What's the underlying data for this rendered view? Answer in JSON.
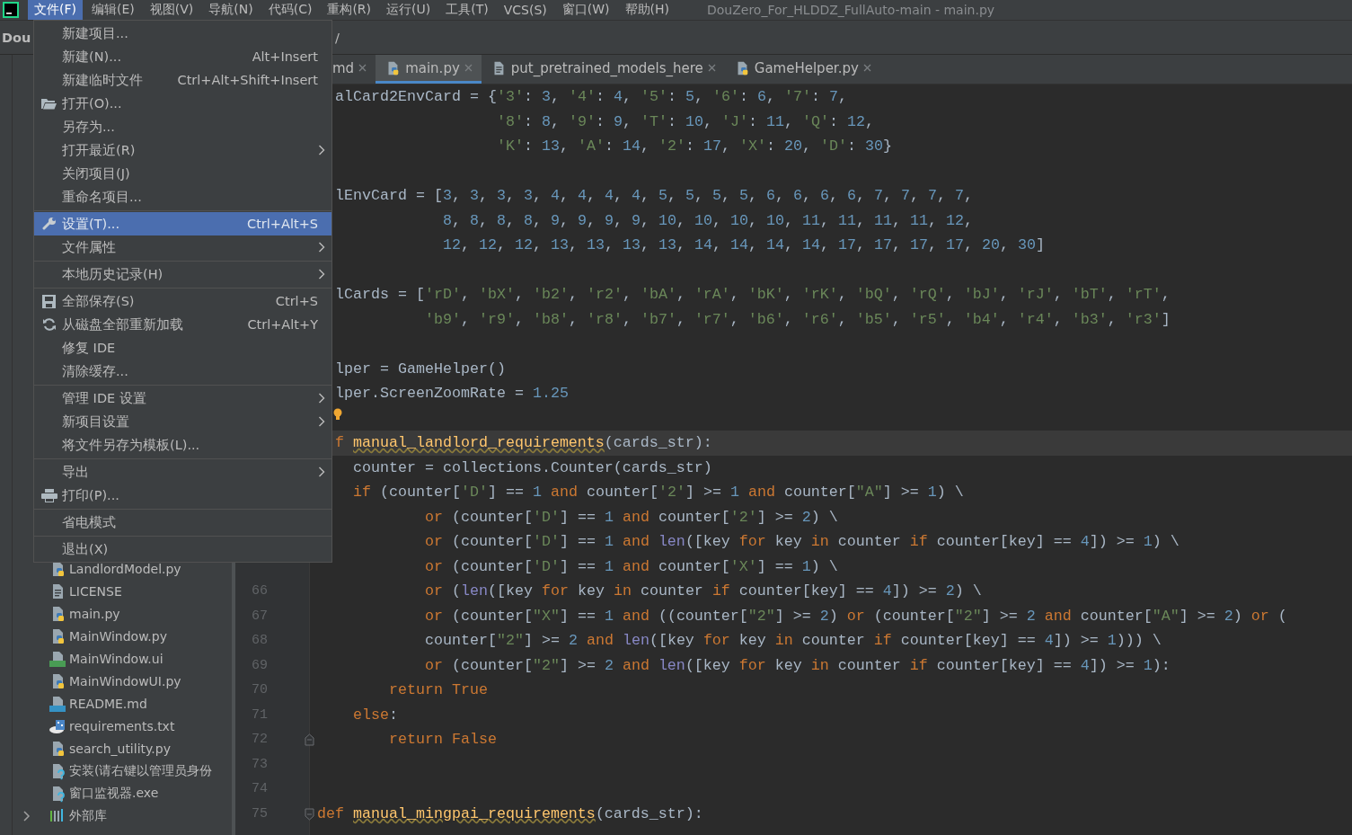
{
  "menu_bar": {
    "items": [
      {
        "label": "文件(F)",
        "selected": true
      },
      {
        "label": "编辑(E)",
        "selected": false
      },
      {
        "label": "视图(V)",
        "selected": false
      },
      {
        "label": "导航(N)",
        "selected": false
      },
      {
        "label": "代码(C)",
        "selected": false
      },
      {
        "label": "重构(R)",
        "selected": false
      },
      {
        "label": "运行(U)",
        "selected": false
      },
      {
        "label": "工具(T)",
        "selected": false
      },
      {
        "label": "VCS(S)",
        "selected": false
      },
      {
        "label": "窗口(W)",
        "selected": false
      },
      {
        "label": "帮助(H)",
        "selected": false
      }
    ],
    "title": "DouZero_For_HLDDZ_FullAuto-main - main.py"
  },
  "navigation_bar": {
    "crumbs": [
      "Dou",
      "/"
    ]
  },
  "file_menu": {
    "groups": [
      {
        "items": [
          {
            "label": "新建项目...",
            "submenu": false,
            "selected": false
          },
          {
            "label": "新建(N)...",
            "shortcut": "Alt+Insert",
            "submenu": false,
            "selected": false
          },
          {
            "label": "新建临时文件",
            "shortcut": "Ctrl+Alt+Shift+Insert",
            "submenu": false,
            "selected": false
          },
          {
            "label": "打开(O)...",
            "kind": "folder",
            "submenu": false,
            "selected": false
          },
          {
            "label": "另存为...",
            "submenu": false,
            "selected": false
          },
          {
            "label": "打开最近(R)",
            "submenu": true,
            "selected": false
          },
          {
            "label": "关闭项目(J)",
            "submenu": false,
            "selected": false
          },
          {
            "label": "重命名项目...",
            "submenu": false,
            "selected": false
          }
        ]
      },
      {
        "items": [
          {
            "label": "设置(T)...",
            "shortcut": "Ctrl+Alt+S",
            "kind": "wrench",
            "submenu": false,
            "selected": true
          },
          {
            "label": "文件属性",
            "submenu": true,
            "selected": false
          }
        ]
      },
      {
        "items": [
          {
            "label": "本地历史记录(H)",
            "submenu": true,
            "selected": false
          }
        ]
      },
      {
        "items": [
          {
            "label": "全部保存(S)",
            "shortcut": "Ctrl+S",
            "kind": "save",
            "submenu": false,
            "selected": false
          },
          {
            "label": "从磁盘全部重新加载",
            "shortcut": "Ctrl+Alt+Y",
            "kind": "reload",
            "submenu": false,
            "selected": false
          },
          {
            "label": "修复 IDE",
            "submenu": false,
            "selected": false
          },
          {
            "label": "清除缓存...",
            "submenu": false,
            "selected": false
          }
        ]
      },
      {
        "items": [
          {
            "label": "管理 IDE 设置",
            "submenu": true,
            "selected": false
          },
          {
            "label": "新项目设置",
            "submenu": true,
            "selected": false
          },
          {
            "label": "将文件另存为模板(L)...",
            "submenu": false,
            "selected": false
          }
        ]
      },
      {
        "items": [
          {
            "label": "导出",
            "submenu": true,
            "selected": false
          },
          {
            "label": "打印(P)...",
            "kind": "printer",
            "submenu": false,
            "selected": false
          }
        ]
      },
      {
        "items": [
          {
            "label": "省电模式",
            "submenu": false,
            "selected": false
          }
        ]
      },
      {
        "items": [
          {
            "label": "退出(X)",
            "submenu": false,
            "selected": false
          }
        ]
      }
    ]
  },
  "project_tree": {
    "items": [
      {
        "kind": "python",
        "label": "LandlordModel.py"
      },
      {
        "kind": "text",
        "label": "LICENSE"
      },
      {
        "kind": "python",
        "label": "main.py"
      },
      {
        "kind": "python",
        "label": "MainWindow.py"
      },
      {
        "kind": "qt",
        "label": "MainWindow.ui"
      },
      {
        "kind": "python",
        "label": "MainWindowUI.py"
      },
      {
        "kind": "markdown",
        "label": "README.md"
      },
      {
        "kind": "requirements",
        "label": "requirements.txt"
      },
      {
        "kind": "python",
        "label": "search_utility.py"
      },
      {
        "kind": "unknown",
        "label": "安装(请右键以管理员身份"
      },
      {
        "kind": "unknown",
        "label": "窗口监视器.exe"
      },
      {
        "kind": "library",
        "label": "外部库",
        "expanded": false
      }
    ]
  },
  "tabs": [
    {
      "label": "md",
      "selected": false
    },
    {
      "label": "main.py",
      "kind": "python",
      "selected": true
    },
    {
      "label": "put_pretrained_models_here",
      "kind": "text",
      "selected": false
    },
    {
      "label": "GameHelper.py",
      "kind": "python",
      "selected": false
    }
  ],
  "editor": {
    "lines": [
      {
        "kind": "code",
        "current": false,
        "tokens": [
          "  alCard2EnvCard = {",
          {
            "str": "'3'"
          },
          ": ",
          {
            "num": "3"
          },
          ", ",
          {
            "str": "'4'"
          },
          ": ",
          {
            "num": "4"
          },
          ", ",
          {
            "str": "'5'"
          },
          ": ",
          {
            "num": "5"
          },
          ", ",
          {
            "str": "'6'"
          },
          ": ",
          {
            "num": "6"
          },
          ", ",
          {
            "str": "'7'"
          },
          ": ",
          {
            "num": "7"
          },
          ","
        ]
      },
      {
        "kind": "code",
        "current": false,
        "tokens": [
          {
            "str": "                    '8'"
          },
          ": ",
          {
            "num": "8"
          },
          ", ",
          {
            "str": "'9'"
          },
          ": ",
          {
            "num": "9"
          },
          ", ",
          {
            "str": "'T'"
          },
          ": ",
          {
            "num": "10"
          },
          ", ",
          {
            "str": "'J'"
          },
          ": ",
          {
            "num": "11"
          },
          ", ",
          {
            "str": "'Q'"
          },
          ": ",
          {
            "num": "12"
          },
          ","
        ]
      },
      {
        "kind": "code",
        "current": false,
        "tokens": [
          {
            "str": "                    'K'"
          },
          ": ",
          {
            "num": "13"
          },
          ", ",
          {
            "str": "'A'"
          },
          ": ",
          {
            "num": "14"
          },
          ", ",
          {
            "str": "'2'"
          },
          ": ",
          {
            "num": "17"
          },
          ", ",
          {
            "str": "'X'"
          },
          ": ",
          {
            "num": "20"
          },
          ", ",
          {
            "str": "'D'"
          },
          ": ",
          {
            "num": "30"
          },
          "}"
        ]
      },
      {
        "kind": "code",
        "current": false
      },
      {
        "kind": "code",
        "current": false,
        "tokens": [
          "  lEnvCard = [",
          {
            "num": "3"
          },
          ", ",
          {
            "num": "3"
          },
          ", ",
          {
            "num": "3"
          },
          ", ",
          {
            "num": "3"
          },
          ", ",
          {
            "num": "4"
          },
          ", ",
          {
            "num": "4"
          },
          ", ",
          {
            "num": "4"
          },
          ", ",
          {
            "num": "4"
          },
          ", ",
          {
            "num": "5"
          },
          ", ",
          {
            "num": "5"
          },
          ", ",
          {
            "num": "5"
          },
          ", ",
          {
            "num": "5"
          },
          ", ",
          {
            "num": "6"
          },
          ", ",
          {
            "num": "6"
          },
          ", ",
          {
            "num": "6"
          },
          ", ",
          {
            "num": "6"
          },
          ", ",
          {
            "num": "7"
          },
          ", ",
          {
            "num": "7"
          },
          ", ",
          {
            "num": "7"
          },
          ", ",
          {
            "num": "7"
          },
          ","
        ]
      },
      {
        "kind": "code",
        "current": false,
        "tokens": [
          {
            "num": "              8"
          },
          ", ",
          {
            "num": "8"
          },
          ", ",
          {
            "num": "8"
          },
          ", ",
          {
            "num": "8"
          },
          ", ",
          {
            "num": "9"
          },
          ", ",
          {
            "num": "9"
          },
          ", ",
          {
            "num": "9"
          },
          ", ",
          {
            "num": "9"
          },
          ", ",
          {
            "num": "10"
          },
          ", ",
          {
            "num": "10"
          },
          ", ",
          {
            "num": "10"
          },
          ", ",
          {
            "num": "10"
          },
          ", ",
          {
            "num": "11"
          },
          ", ",
          {
            "num": "11"
          },
          ", ",
          {
            "num": "11"
          },
          ", ",
          {
            "num": "11"
          },
          ", ",
          {
            "num": "12"
          },
          ","
        ]
      },
      {
        "kind": "code",
        "current": false,
        "tokens": [
          {
            "num": "              12"
          },
          ", ",
          {
            "num": "12"
          },
          ", ",
          {
            "num": "12"
          },
          ", ",
          {
            "num": "13"
          },
          ", ",
          {
            "num": "13"
          },
          ", ",
          {
            "num": "13"
          },
          ", ",
          {
            "num": "13"
          },
          ", ",
          {
            "num": "14"
          },
          ", ",
          {
            "num": "14"
          },
          ", ",
          {
            "num": "14"
          },
          ", ",
          {
            "num": "14"
          },
          ", ",
          {
            "num": "17"
          },
          ", ",
          {
            "num": "17"
          },
          ", ",
          {
            "num": "17"
          },
          ", ",
          {
            "num": "17"
          },
          ", ",
          {
            "num": "20"
          },
          ", ",
          {
            "num": "30"
          },
          "]"
        ]
      },
      {
        "kind": "code",
        "current": false
      },
      {
        "kind": "code",
        "current": false,
        "tokens": [
          "  lCards = [",
          {
            "str": "'rD'"
          },
          ", ",
          {
            "str": "'bX'"
          },
          ", ",
          {
            "str": "'b2'"
          },
          ", ",
          {
            "str": "'r2'"
          },
          ", ",
          {
            "str": "'bA'"
          },
          ", ",
          {
            "str": "'rA'"
          },
          ", ",
          {
            "str": "'bK'"
          },
          ", ",
          {
            "str": "'rK'"
          },
          ", ",
          {
            "str": "'bQ'"
          },
          ", ",
          {
            "str": "'rQ'"
          },
          ", ",
          {
            "str": "'bJ'"
          },
          ", ",
          {
            "str": "'rJ'"
          },
          ", ",
          {
            "str": "'bT'"
          },
          ", ",
          {
            "str": "'rT'"
          },
          ","
        ]
      },
      {
        "kind": "code",
        "current": false,
        "tokens": [
          {
            "str": "            'b9'"
          },
          ", ",
          {
            "str": "'r9'"
          },
          ", ",
          {
            "str": "'b8'"
          },
          ", ",
          {
            "str": "'r8'"
          },
          ", ",
          {
            "str": "'b7'"
          },
          ", ",
          {
            "str": "'r7'"
          },
          ", ",
          {
            "str": "'b6'"
          },
          ", ",
          {
            "str": "'r6'"
          },
          ", ",
          {
            "str": "'b5'"
          },
          ", ",
          {
            "str": "'r5'"
          },
          ", ",
          {
            "str": "'b4'"
          },
          ", ",
          {
            "str": "'r4'"
          },
          ", ",
          {
            "str": "'b3'"
          },
          ", ",
          {
            "str": "'r3'"
          },
          "]"
        ]
      },
      {
        "kind": "code",
        "current": false
      },
      {
        "kind": "code",
        "current": false,
        "tokens": [
          "  lper = GameHelper()"
        ]
      },
      {
        "kind": "code",
        "current": false,
        "tokens": [
          "  lper.ScreenZoomRate = ",
          {
            "num": "1.25"
          }
        ]
      },
      {
        "kind": "bulb",
        "current": false
      },
      {
        "kind": "code",
        "current": true,
        "tokens": [
          {
            "kw": "  f "
          },
          {
            "fn": "manual_landlord_requirements"
          },
          "(cards_str):"
        ]
      },
      {
        "kind": "code",
        "current": false,
        "tokens": [
          "    counter = collections.Counter(cards_str)"
        ]
      },
      {
        "kind": "code",
        "current": false,
        "tokens": [
          {
            "kw": "    if"
          },
          " (counter[",
          {
            "str": "'D'"
          },
          "] == ",
          {
            "num": "1 "
          },
          {
            "kw": "and"
          },
          " counter[",
          {
            "str": "'2'"
          },
          "] >= ",
          {
            "num": "1 "
          },
          {
            "kw": "and"
          },
          " counter[",
          {
            "str": "\"A\""
          },
          "] >= ",
          {
            "num": "1"
          },
          ") \\"
        ]
      },
      {
        "kind": "code",
        "current": false,
        "tokens": [
          {
            "kw": "            or"
          },
          " (counter[",
          {
            "str": "'D'"
          },
          "] == ",
          {
            "num": "1 "
          },
          {
            "kw": "and"
          },
          " counter[",
          {
            "str": "'2'"
          },
          "] >= ",
          {
            "num": "2"
          },
          ") \\"
        ]
      },
      {
        "kind": "code",
        "current": false,
        "tokens": [
          {
            "kw": "            or"
          },
          " (counter[",
          {
            "str": "'D'"
          },
          "] == ",
          {
            "num": "1 "
          },
          {
            "kw": "and "
          },
          {
            "builtin": "len"
          },
          "([key ",
          {
            "kw": "for"
          },
          " key ",
          {
            "kw": "in"
          },
          " counter ",
          {
            "kw": "if"
          },
          " counter[key] == ",
          {
            "num": "4"
          },
          "]) >= ",
          {
            "num": "1"
          },
          ") \\"
        ]
      },
      {
        "kind": "code",
        "current": false,
        "tokens": [
          {
            "kw": "            or"
          },
          " (counter[",
          {
            "str": "'D'"
          },
          "] == ",
          {
            "num": "1 "
          },
          {
            "kw": "and"
          },
          " counter[",
          {
            "str": "'X'"
          },
          "] == ",
          {
            "num": "1"
          },
          ") \\"
        ]
      },
      {
        "kind": "code",
        "number": "66",
        "current": false,
        "tokens": [
          {
            "kw": "            or"
          },
          " (",
          {
            "builtin": "len"
          },
          "([key ",
          {
            "kw": "for"
          },
          " key ",
          {
            "kw": "in"
          },
          " counter ",
          {
            "kw": "if"
          },
          " counter[key] == ",
          {
            "num": "4"
          },
          "]) >= ",
          {
            "num": "2"
          },
          ") \\"
        ]
      },
      {
        "kind": "code",
        "number": "67",
        "current": false,
        "tokens": [
          {
            "kw": "            or"
          },
          " (counter[",
          {
            "str": "\"X\""
          },
          "] == ",
          {
            "num": "1 "
          },
          {
            "kw": "and"
          },
          " ((counter[",
          {
            "str": "\"2\""
          },
          "] >= ",
          {
            "num": "2"
          },
          ") ",
          {
            "kw": "or"
          },
          " (counter[",
          {
            "str": "\"2\""
          },
          "] >= ",
          {
            "num": "2 "
          },
          {
            "kw": "and"
          },
          " counter[",
          {
            "str": "\"A\""
          },
          "] >= ",
          {
            "num": "2"
          },
          ") ",
          {
            "kw": "or"
          },
          " ("
        ]
      },
      {
        "kind": "code",
        "number": "68",
        "current": false,
        "tokens": [
          "            counter[",
          {
            "str": "\"2\""
          },
          "] >= ",
          {
            "num": "2 "
          },
          {
            "kw": "and "
          },
          {
            "builtin": "len"
          },
          "([key ",
          {
            "kw": "for"
          },
          " key ",
          {
            "kw": "in"
          },
          " counter ",
          {
            "kw": "if"
          },
          " counter[key] == ",
          {
            "num": "4"
          },
          "]) >= ",
          {
            "num": "1"
          },
          "))) \\"
        ]
      },
      {
        "kind": "code",
        "number": "69",
        "current": false,
        "tokens": [
          {
            "kw": "            or"
          },
          " (counter[",
          {
            "str": "\"2\""
          },
          "] >= ",
          {
            "num": "2 "
          },
          {
            "kw": "and "
          },
          {
            "builtin": "len"
          },
          "([key ",
          {
            "kw": "for"
          },
          " key ",
          {
            "kw": "in"
          },
          " counter ",
          {
            "kw": "if"
          },
          " counter[key] == ",
          {
            "num": "4"
          },
          "]) >= ",
          {
            "num": "1"
          },
          "):"
        ]
      },
      {
        "kind": "code",
        "number": "70",
        "current": false,
        "tokens": [
          {
            "kw": "        return True"
          }
        ]
      },
      {
        "kind": "code",
        "number": "71",
        "current": false,
        "tokens": [
          {
            "kw": "    else"
          },
          ":"
        ]
      },
      {
        "kind": "fold_end",
        "number": "72",
        "current": false,
        "tokens": [
          {
            "kw": "        return False"
          }
        ]
      },
      {
        "kind": "code",
        "number": "73",
        "current": false
      },
      {
        "kind": "code",
        "number": "74",
        "current": false
      },
      {
        "kind": "fold_start",
        "number": "75",
        "current": false,
        "tokens": [
          {
            "kw": "def "
          },
          {
            "fn": "manual_mingpai_requirements"
          },
          "(cards_str):"
        ]
      }
    ]
  }
}
